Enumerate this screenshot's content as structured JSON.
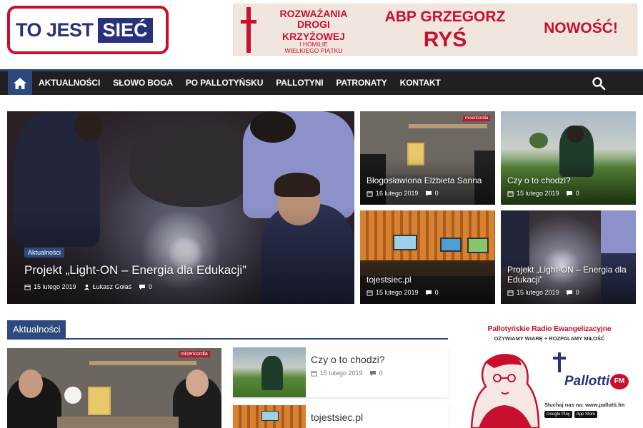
{
  "header": {
    "logo_part1": "TO JEST",
    "logo_part2": "SIEĆ",
    "banner": {
      "line1": "ROZWAŻANIA",
      "line2": "DROGI",
      "line3": "KRZYŻOWEJ",
      "line4": "I HOMILIE",
      "line5": "WIELKIEGO PIĄTKU",
      "author_first": "ABP GRZEGORZ",
      "author_last": "RYŚ",
      "badge": "NOWOŚĆ!"
    }
  },
  "nav": {
    "items": [
      "AKTUALNOŚCI",
      "SŁOWO BOGA",
      "PO PALLOTYŃSKU",
      "PALLOTYNI",
      "PATRONATY",
      "KONTAKT"
    ]
  },
  "featured": {
    "main": {
      "category": "Aktualności",
      "title": "Projekt „Light-ON – Energia dla Edukacji”",
      "date": "15 lutego 2019",
      "author": "Łukasz Gołaś",
      "comments": "0"
    },
    "tiles": [
      {
        "title": "Błogosławiona Elżbieta Sanna",
        "date": "16 lutego 2019",
        "comments": "0",
        "watermark": "misericordia"
      },
      {
        "title": "Czy o to chodzi?",
        "date": "15 lutego 2019",
        "comments": "0"
      },
      {
        "title": "tojestsiec.pl",
        "date": "15 lutego 2019",
        "comments": "0"
      },
      {
        "title": "Projekt „Light-ON – Energia dla Edukacji”",
        "date": "15 lutego 2019",
        "comments": "0"
      }
    ]
  },
  "section": {
    "title": "Aktualności",
    "big_watermark": "misericordia",
    "cards": [
      {
        "title": "Czy o to chodzi?",
        "date": "15 lutego 2019",
        "comments": "0"
      },
      {
        "title": "tojestsiec.pl"
      }
    ]
  },
  "sidebar_ad": {
    "line1": "Pallotyńskie Radio Ewangelizacyjne",
    "line2": "OŻYWIAMY WIARĘ + ROZPALAMY MIŁOŚĆ",
    "brand": "Pallotti",
    "fm": "FM",
    "listen": "Słuchaj nas na: www.pallotti.fm",
    "store1": "Google Play",
    "store2": "App Store"
  },
  "colors": {
    "accent": "#2e4a7d",
    "nav_bg": "#231f20",
    "brand_red": "#c8102e",
    "logo_blue": "#27317d"
  }
}
